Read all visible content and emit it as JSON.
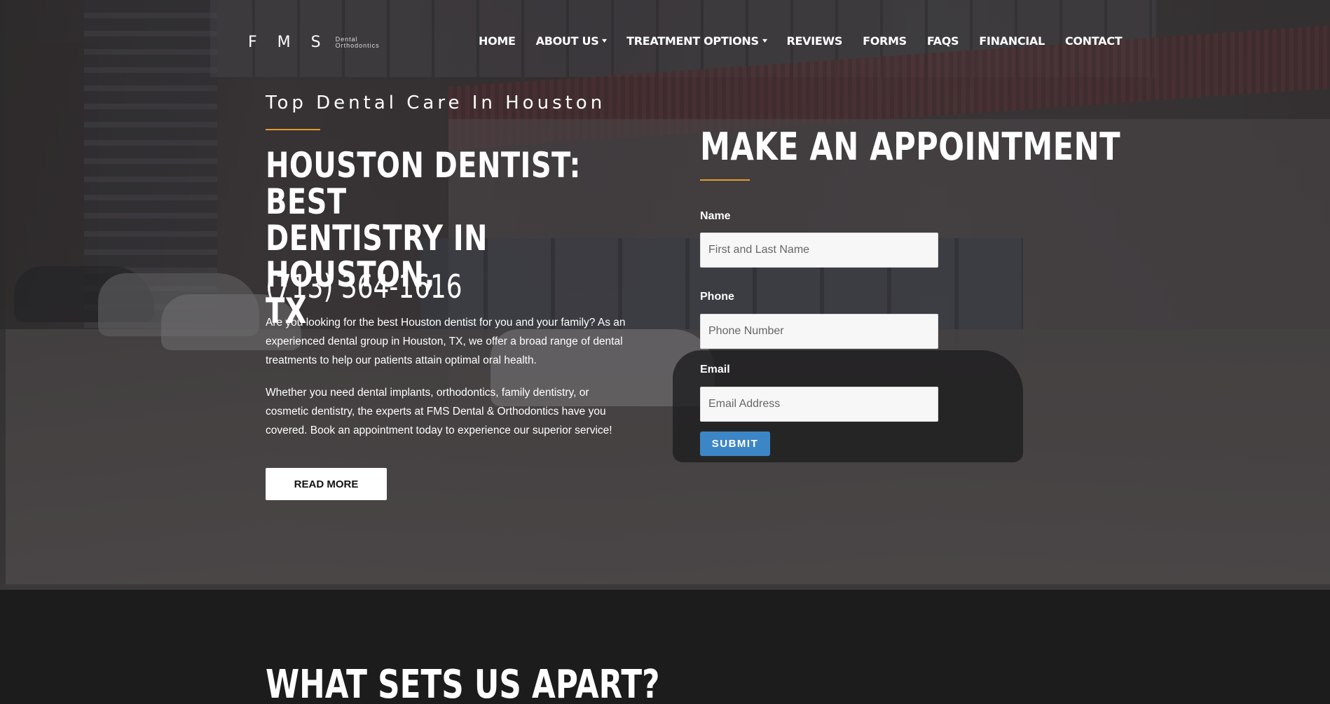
{
  "logo": {
    "mark": "F M S",
    "line1": "Dental",
    "line2": "Orthodontics"
  },
  "nav": {
    "items": [
      {
        "label": "HOME",
        "dropdown": false
      },
      {
        "label": "ABOUT US",
        "dropdown": true
      },
      {
        "label": "TREATMENT OPTIONS",
        "dropdown": true
      },
      {
        "label": "REVIEWS",
        "dropdown": false
      },
      {
        "label": "FORMS",
        "dropdown": false
      },
      {
        "label": "FAQS",
        "dropdown": false
      },
      {
        "label": "FINANCIAL",
        "dropdown": false
      },
      {
        "label": "CONTACT",
        "dropdown": false
      }
    ],
    "chevron": "▾"
  },
  "hero": {
    "eyebrow": "Top Dental Care In Houston",
    "title_line1": "HOUSTON DENTIST: BEST",
    "title_line2": "DENTISTRY IN HOUSTON,",
    "title_line3": "TX",
    "phone": "(713) 364-1616",
    "para1": "Are you looking for the best Houston dentist for you and your family? As an experienced dental group in Houston, TX, we offer a broad range of dental treatments to help our patients attain optimal oral health.",
    "para2": "Whether you need dental implants, orthodontics, family dentistry, or cosmetic dentistry, the experts at FMS Dental & Orthodontics have you covered. Book an appointment today to experience our superior service!",
    "read_more": "READ MORE"
  },
  "form": {
    "title": "MAKE AN APPOINTMENT",
    "name_label": "Name",
    "name_placeholder": "First and Last Name",
    "phone_label": "Phone",
    "phone_placeholder": "Phone Number",
    "email_label": "Email",
    "email_placeholder": "Email Address",
    "submit": "SUBMIT"
  },
  "section": {
    "title": "WHAT SETS US APART?"
  },
  "colors": {
    "accent": "#e39b2b",
    "submit": "#3d86c6",
    "dark_bg": "#1c1c1c"
  }
}
